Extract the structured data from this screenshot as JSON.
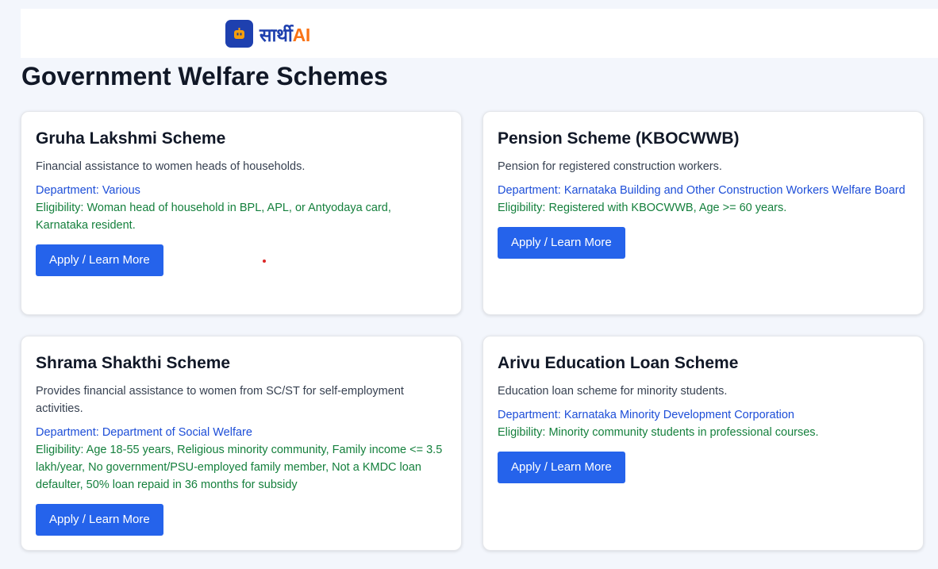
{
  "header": {
    "logo_text_main": "सार्थी",
    "logo_text_accent": "AI"
  },
  "page": {
    "title": "Government Welfare Schemes"
  },
  "schemes": [
    {
      "title": "Gruha Lakshmi Scheme",
      "description": "Financial assistance to women heads of households.",
      "department": "Department: Various",
      "eligibility": "Eligibility: Woman head of household in BPL, APL, or Antyodaya card, Karnataka resident.",
      "button_label": "Apply / Learn More"
    },
    {
      "title": "Pension Scheme (KBOCWWB)",
      "description": "Pension for registered construction workers.",
      "department": "Department: Karnataka Building and Other Construction Workers Welfare Board",
      "eligibility": "Eligibility: Registered with KBOCWWB, Age >= 60 years.",
      "button_label": "Apply / Learn More"
    },
    {
      "title": "Shrama Shakthi Scheme",
      "description": "Provides financial assistance to women from SC/ST for self-employment activities.",
      "department": "Department: Department of Social Welfare",
      "eligibility": "Eligibility: Age 18-55 years, Religious minority community, Family income <= 3.5 lakh/year, No government/PSU-employed family member, Not a KMDC loan defaulter, 50% loan repaid in 36 months for subsidy",
      "button_label": "Apply / Learn More"
    },
    {
      "title": "Arivu Education Loan Scheme",
      "description": "Education loan scheme for minority students.",
      "department": "Department: Karnataka Minority Development Corporation",
      "eligibility": "Eligibility: Minority community students in professional courses.",
      "button_label": "Apply / Learn More"
    }
  ],
  "colors": {
    "brand_primary": "#1e40af",
    "brand_accent": "#f97316",
    "button": "#2563eb",
    "department_text": "#1d4ed8",
    "eligibility_text": "#15803d"
  }
}
